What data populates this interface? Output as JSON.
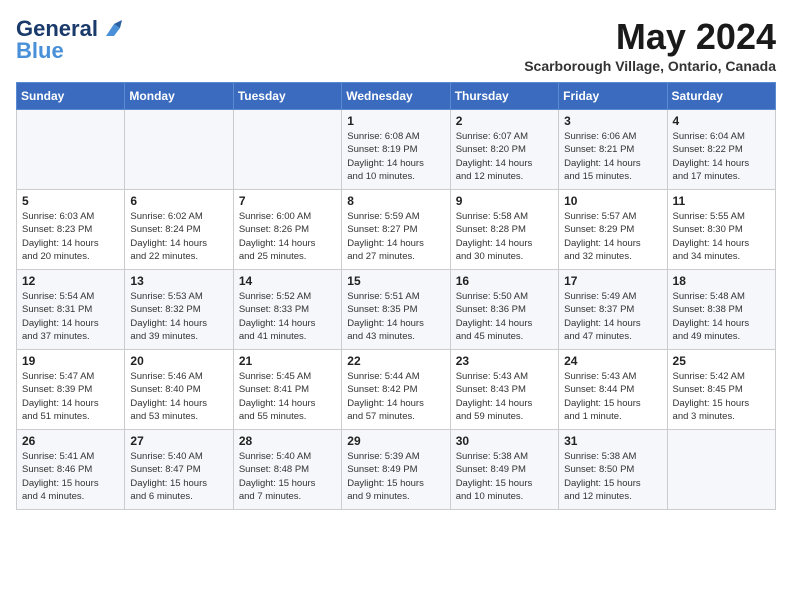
{
  "header": {
    "logo_line1": "General",
    "logo_line2": "Blue",
    "month_title": "May 2024",
    "subtitle": "Scarborough Village, Ontario, Canada"
  },
  "weekdays": [
    "Sunday",
    "Monday",
    "Tuesday",
    "Wednesday",
    "Thursday",
    "Friday",
    "Saturday"
  ],
  "weeks": [
    [
      {
        "day": "",
        "info": ""
      },
      {
        "day": "",
        "info": ""
      },
      {
        "day": "",
        "info": ""
      },
      {
        "day": "1",
        "info": "Sunrise: 6:08 AM\nSunset: 8:19 PM\nDaylight: 14 hours\nand 10 minutes."
      },
      {
        "day": "2",
        "info": "Sunrise: 6:07 AM\nSunset: 8:20 PM\nDaylight: 14 hours\nand 12 minutes."
      },
      {
        "day": "3",
        "info": "Sunrise: 6:06 AM\nSunset: 8:21 PM\nDaylight: 14 hours\nand 15 minutes."
      },
      {
        "day": "4",
        "info": "Sunrise: 6:04 AM\nSunset: 8:22 PM\nDaylight: 14 hours\nand 17 minutes."
      }
    ],
    [
      {
        "day": "5",
        "info": "Sunrise: 6:03 AM\nSunset: 8:23 PM\nDaylight: 14 hours\nand 20 minutes."
      },
      {
        "day": "6",
        "info": "Sunrise: 6:02 AM\nSunset: 8:24 PM\nDaylight: 14 hours\nand 22 minutes."
      },
      {
        "day": "7",
        "info": "Sunrise: 6:00 AM\nSunset: 8:26 PM\nDaylight: 14 hours\nand 25 minutes."
      },
      {
        "day": "8",
        "info": "Sunrise: 5:59 AM\nSunset: 8:27 PM\nDaylight: 14 hours\nand 27 minutes."
      },
      {
        "day": "9",
        "info": "Sunrise: 5:58 AM\nSunset: 8:28 PM\nDaylight: 14 hours\nand 30 minutes."
      },
      {
        "day": "10",
        "info": "Sunrise: 5:57 AM\nSunset: 8:29 PM\nDaylight: 14 hours\nand 32 minutes."
      },
      {
        "day": "11",
        "info": "Sunrise: 5:55 AM\nSunset: 8:30 PM\nDaylight: 14 hours\nand 34 minutes."
      }
    ],
    [
      {
        "day": "12",
        "info": "Sunrise: 5:54 AM\nSunset: 8:31 PM\nDaylight: 14 hours\nand 37 minutes."
      },
      {
        "day": "13",
        "info": "Sunrise: 5:53 AM\nSunset: 8:32 PM\nDaylight: 14 hours\nand 39 minutes."
      },
      {
        "day": "14",
        "info": "Sunrise: 5:52 AM\nSunset: 8:33 PM\nDaylight: 14 hours\nand 41 minutes."
      },
      {
        "day": "15",
        "info": "Sunrise: 5:51 AM\nSunset: 8:35 PM\nDaylight: 14 hours\nand 43 minutes."
      },
      {
        "day": "16",
        "info": "Sunrise: 5:50 AM\nSunset: 8:36 PM\nDaylight: 14 hours\nand 45 minutes."
      },
      {
        "day": "17",
        "info": "Sunrise: 5:49 AM\nSunset: 8:37 PM\nDaylight: 14 hours\nand 47 minutes."
      },
      {
        "day": "18",
        "info": "Sunrise: 5:48 AM\nSunset: 8:38 PM\nDaylight: 14 hours\nand 49 minutes."
      }
    ],
    [
      {
        "day": "19",
        "info": "Sunrise: 5:47 AM\nSunset: 8:39 PM\nDaylight: 14 hours\nand 51 minutes."
      },
      {
        "day": "20",
        "info": "Sunrise: 5:46 AM\nSunset: 8:40 PM\nDaylight: 14 hours\nand 53 minutes."
      },
      {
        "day": "21",
        "info": "Sunrise: 5:45 AM\nSunset: 8:41 PM\nDaylight: 14 hours\nand 55 minutes."
      },
      {
        "day": "22",
        "info": "Sunrise: 5:44 AM\nSunset: 8:42 PM\nDaylight: 14 hours\nand 57 minutes."
      },
      {
        "day": "23",
        "info": "Sunrise: 5:43 AM\nSunset: 8:43 PM\nDaylight: 14 hours\nand 59 minutes."
      },
      {
        "day": "24",
        "info": "Sunrise: 5:43 AM\nSunset: 8:44 PM\nDaylight: 15 hours\nand 1 minute."
      },
      {
        "day": "25",
        "info": "Sunrise: 5:42 AM\nSunset: 8:45 PM\nDaylight: 15 hours\nand 3 minutes."
      }
    ],
    [
      {
        "day": "26",
        "info": "Sunrise: 5:41 AM\nSunset: 8:46 PM\nDaylight: 15 hours\nand 4 minutes."
      },
      {
        "day": "27",
        "info": "Sunrise: 5:40 AM\nSunset: 8:47 PM\nDaylight: 15 hours\nand 6 minutes."
      },
      {
        "day": "28",
        "info": "Sunrise: 5:40 AM\nSunset: 8:48 PM\nDaylight: 15 hours\nand 7 minutes."
      },
      {
        "day": "29",
        "info": "Sunrise: 5:39 AM\nSunset: 8:49 PM\nDaylight: 15 hours\nand 9 minutes."
      },
      {
        "day": "30",
        "info": "Sunrise: 5:38 AM\nSunset: 8:49 PM\nDaylight: 15 hours\nand 10 minutes."
      },
      {
        "day": "31",
        "info": "Sunrise: 5:38 AM\nSunset: 8:50 PM\nDaylight: 15 hours\nand 12 minutes."
      },
      {
        "day": "",
        "info": ""
      }
    ]
  ]
}
